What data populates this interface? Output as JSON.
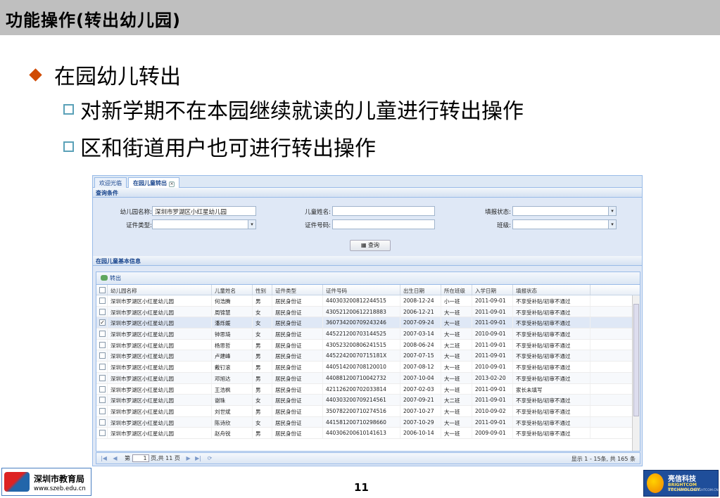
{
  "slide": {
    "title": "功能操作(转出幼儿园)",
    "bullet1": "在园幼儿转出",
    "bullet2": "对新学期不在本园继续就读的儿童进行转出操作",
    "bullet3": "区和街道用户也可进行转出操作",
    "page_number": "11"
  },
  "app": {
    "tabs": [
      {
        "label": "欢迎光临"
      },
      {
        "label": "在园儿童转出"
      }
    ],
    "query_panel_title": "查询条件",
    "query": {
      "kindergarten_label": "幼儿园名称:",
      "kindergarten_value": "深圳市罗湖区小红星幼儿园",
      "child_name_label": "儿童姓名:",
      "child_name_value": "",
      "fill_status_label": "填报状态:",
      "fill_status_value": "",
      "id_type_label": "证件类型:",
      "id_type_value": "",
      "id_number_label": "证件号码:",
      "id_number_value": "",
      "class_label": "班级:",
      "class_value": "",
      "search_button": "查询"
    },
    "grid_panel_title": "在园儿童基本信息",
    "toolbar_transfer": "转出",
    "columns": [
      "幼儿园名称",
      "儿童姓名",
      "性别",
      "证件类型",
      "证件号码",
      "出生日期",
      "所在班级",
      "入学日期",
      "填报状态"
    ],
    "rows": [
      [
        "深圳市罗湖区小红星幼儿园",
        "何浩腾",
        "男",
        "居民身份证",
        "440303200812244515",
        "2008-12-24",
        "小一班",
        "2011-09-01",
        "不享受补贴/初审不通过"
      ],
      [
        "深圳市罗湖区小红星幼儿园",
        "周锦慧",
        "女",
        "居民身份证",
        "430521200612218883",
        "2006-12-21",
        "大一班",
        "2011-09-01",
        "不享受补贴/初审不通过"
      ],
      [
        "深圳市罗湖区小红星幼儿园",
        "潘烁媛",
        "女",
        "居民身份证",
        "360734200709243246",
        "2007-09-24",
        "大一班",
        "2011-09-01",
        "不享受补贴/初审不通过"
      ],
      [
        "深圳市罗湖区小红星幼儿园",
        "钟思琦",
        "女",
        "居民身份证",
        "445221200703144525",
        "2007-03-14",
        "大一班",
        "2010-09-01",
        "不享受补贴/初审不通过"
      ],
      [
        "深圳市罗湖区小红星幼儿园",
        "杨思哲",
        "男",
        "居民身份证",
        "430523200806241515",
        "2008-06-24",
        "大二班",
        "2011-09-01",
        "不享受补贴/初审不通过"
      ],
      [
        "深圳市罗湖区小红星幼儿园",
        "卢建峰",
        "男",
        "居民身份证",
        "44522420070715181X",
        "2007-07-15",
        "大一班",
        "2011-09-01",
        "不享受补贴/初审不通过"
      ],
      [
        "深圳市罗湖区小红星幼儿园",
        "戴钉滚",
        "男",
        "居民身份证",
        "440514200708120010",
        "2007-08-12",
        "大一班",
        "2010-09-01",
        "不享受补贴/初审不通过"
      ],
      [
        "深圳市罗湖区小红星幼儿园",
        "邓旭达",
        "男",
        "居民身份证",
        "440881200710042732",
        "2007-10-04",
        "大一班",
        "2013-02-20",
        "不享受补贴/初审不通过"
      ],
      [
        "深圳市罗湖区小红星幼儿园",
        "王浩枫",
        "男",
        "居民身份证",
        "421126200702033814",
        "2007-02-03",
        "大一班",
        "2011-09-01",
        "家长未填写"
      ],
      [
        "深圳市罗湖区小红星幼儿园",
        "谢珠",
        "女",
        "居民身份证",
        "440303200709214561",
        "2007-09-21",
        "大二班",
        "2011-09-01",
        "不享受补贴/初审不通过"
      ],
      [
        "深圳市罗湖区小红星幼儿园",
        "刘世斌",
        "男",
        "居民身份证",
        "350782200710274516",
        "2007-10-27",
        "大一班",
        "2010-09-02",
        "不享受补贴/初审不通过"
      ],
      [
        "深圳市罗湖区小红星幼儿园",
        "陈诗欣",
        "女",
        "居民身份证",
        "441581200710298660",
        "2007-10-29",
        "大一班",
        "2011-09-01",
        "不享受补贴/初审不通过"
      ],
      [
        "深圳市罗湖区小红星幼儿园",
        "赵舟锐",
        "男",
        "居民身份证",
        "440306200610141613",
        "2006-10-14",
        "大一班",
        "2009-09-01",
        "不享受补贴/初审不通过"
      ]
    ],
    "selected_row_index": 2,
    "pager": {
      "page_prefix": "第",
      "page_value": "1",
      "page_suffix": "页,共 11 页",
      "info": "显示 1 - 15条, 共 165 条"
    }
  },
  "footer": {
    "left_logo_name": "深圳市教育局",
    "left_logo_url": "www.szeb.edu.cn",
    "right_logo_name": "亮信科技",
    "right_logo_en": "BRIGHTCOM TECHNOLOGY",
    "right_logo_url": "HTTP://WWW.SZBRIGHTCOM.CN"
  },
  "colors": {
    "diamond": "#d04a02",
    "square_bullet": "#5aa1b8",
    "title_bar": "#bfbfbf",
    "panel_blue": "#99bbe8"
  }
}
